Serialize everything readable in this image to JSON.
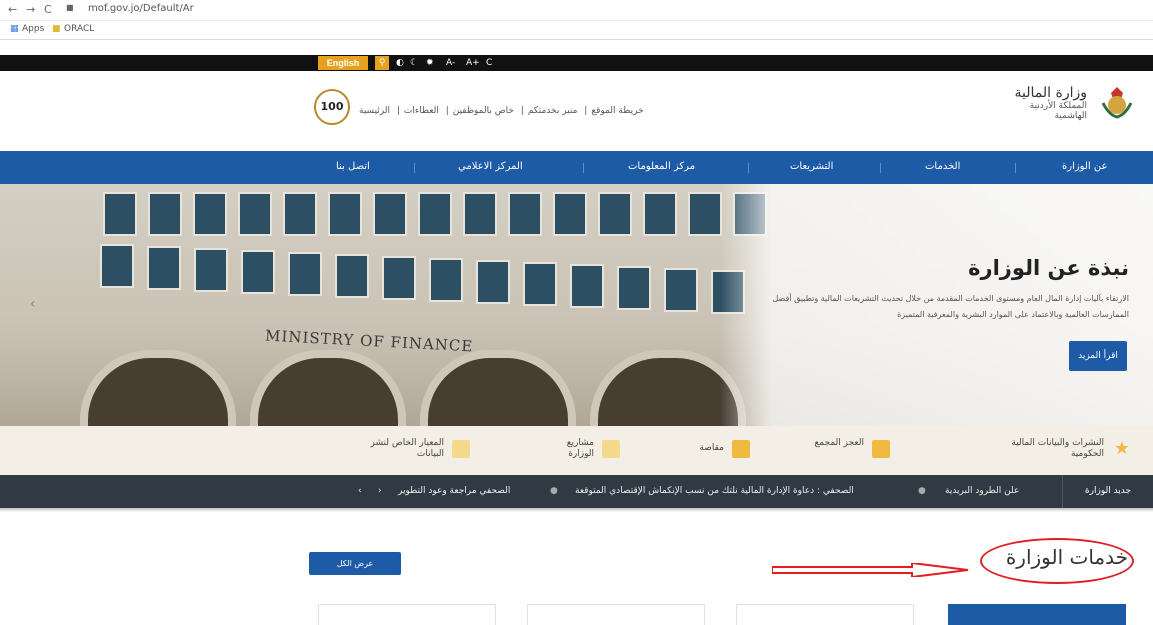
{
  "browser": {
    "nav_back": "←",
    "nav_forward": "→",
    "nav_reload": "C",
    "url": "mof.gov.jo/Default/Ar",
    "bookmarks": [
      {
        "label": "Apps"
      },
      {
        "label": "ORACL"
      }
    ]
  },
  "topbar": {
    "english_label": "English",
    "tools": [
      "A-",
      "A+",
      "C"
    ]
  },
  "header": {
    "centenary_logo_text": "100",
    "top_links": [
      "الرئيسية",
      "العطاءات",
      "خاص بالموظفين",
      "منبر بخدمتكم",
      "خريطة الموقع"
    ],
    "ministry_name": "وزارة المالية",
    "ministry_subtitle": "المملكة الأردنية الهاشمية"
  },
  "main_nav": {
    "items": [
      "عن الوزارة",
      "الخدمات",
      "التشريعات",
      "مركز المعلومات",
      "المركز الاعلامي",
      "اتصل بنا"
    ]
  },
  "hero": {
    "sign_text": "MINISTRY OF FINANCE",
    "title": "نبذة عن الوزارة",
    "description": "الارتقاء بآليات إدارة المال العام ومستوى الخدمات المقدمة من خلال تحديث التشريعات المالية وتطبيق أفضل الممارسات العالمية وبالاعتماد على الموارد البشرية والمعرفية المتميزة",
    "button_label": "اقرأ المزيد"
  },
  "quick_links": [
    {
      "label": "النشرات والبيانات المالية الحكومية",
      "icon": "star-icon"
    },
    {
      "label": "العجز المجمع",
      "icon": "chart-icon"
    },
    {
      "label": "مقاصة",
      "icon": "exchange-icon"
    },
    {
      "label": "مشاريع الوزارة",
      "icon": "folder-icon"
    },
    {
      "label": "المعيار الخاص لنشر البيانات",
      "icon": "table-icon"
    }
  ],
  "ticker": {
    "label": "جديد الوزارة",
    "items": [
      "علن الطرود البريدية",
      "الصحفي : دعاوة الإدارة المالية نلتك من نسب الإنكماش الإقتصادي المتوقعة",
      "الصحفي مراجعة وعود التطوير"
    ],
    "controls": [
      "‹",
      "›"
    ]
  },
  "services": {
    "title": "خدمات الوزارة",
    "all_button": "عرض الكل"
  },
  "colors": {
    "nav_blue": "#1e5ba6",
    "topbar_black": "#111111",
    "accent_gold": "#e8a11e",
    "annotation_red": "#e01e24"
  }
}
